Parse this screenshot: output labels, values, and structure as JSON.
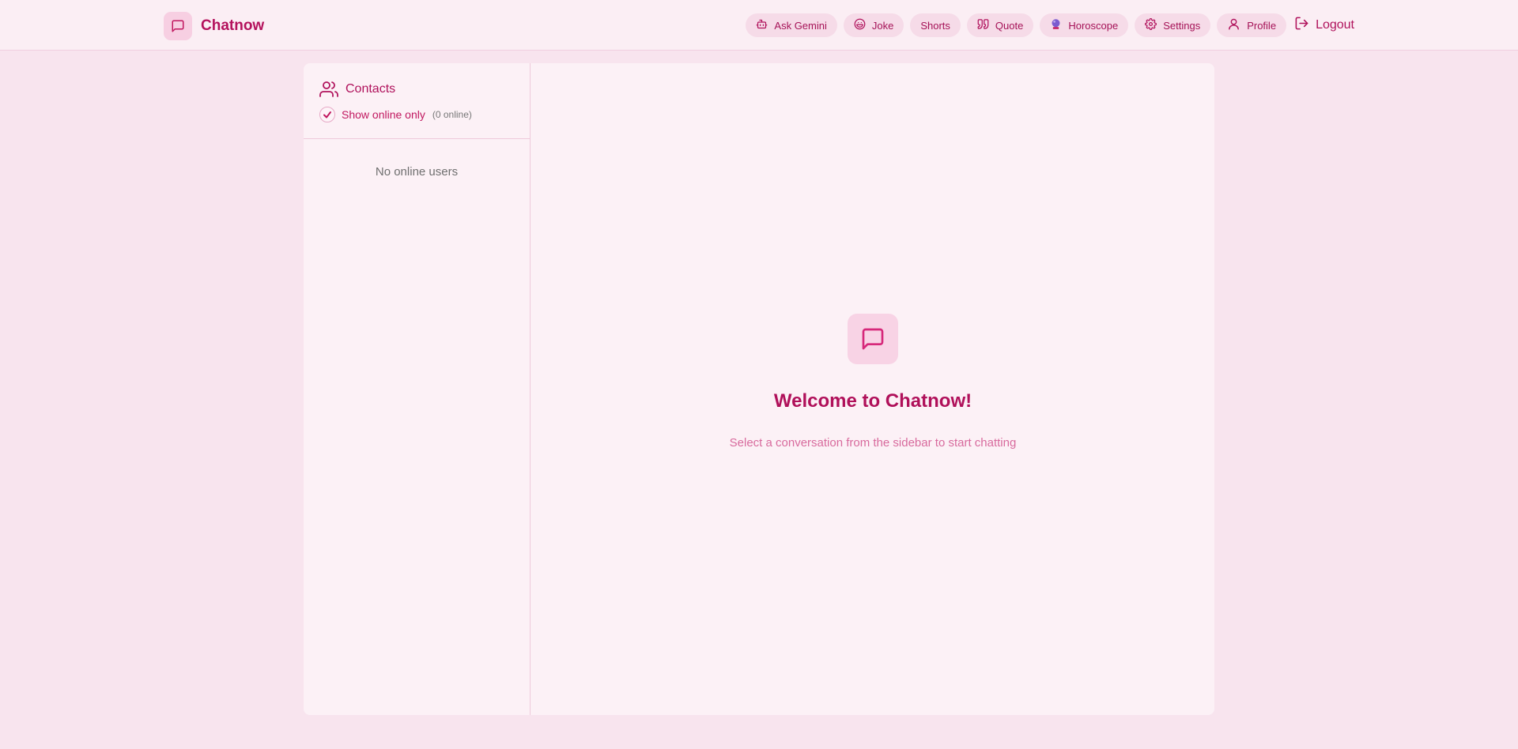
{
  "app": {
    "name": "Chatnow"
  },
  "nav": {
    "ask_gemini": "Ask Gemini",
    "joke": "Joke",
    "shorts": "Shorts",
    "quote": "Quote",
    "horoscope": "Horoscope",
    "settings": "Settings",
    "profile": "Profile",
    "logout": "Logout"
  },
  "sidebar": {
    "title": "Contacts",
    "show_online_label": "Show online only",
    "online_count": "(0 online)",
    "show_online_checked": true,
    "empty_text": "No online users"
  },
  "welcome": {
    "title": "Welcome to Chatnow!",
    "subtitle": "Select a conversation from the sidebar to start chatting"
  },
  "icons": {
    "brand": "message-square-icon",
    "ask_gemini": "bot-icon",
    "joke": "laugh-icon",
    "quote": "quote-icon",
    "horoscope": "crystal-ball-icon",
    "settings": "gear-icon",
    "profile": "user-icon",
    "logout": "logout-icon",
    "contacts": "users-icon",
    "checkbox": "check-icon",
    "welcome": "message-square-icon"
  },
  "colors": {
    "accent": "#b0125c",
    "background": "#f8e4ee",
    "surface": "#fcf1f6",
    "pill": "#f6dbe8"
  }
}
